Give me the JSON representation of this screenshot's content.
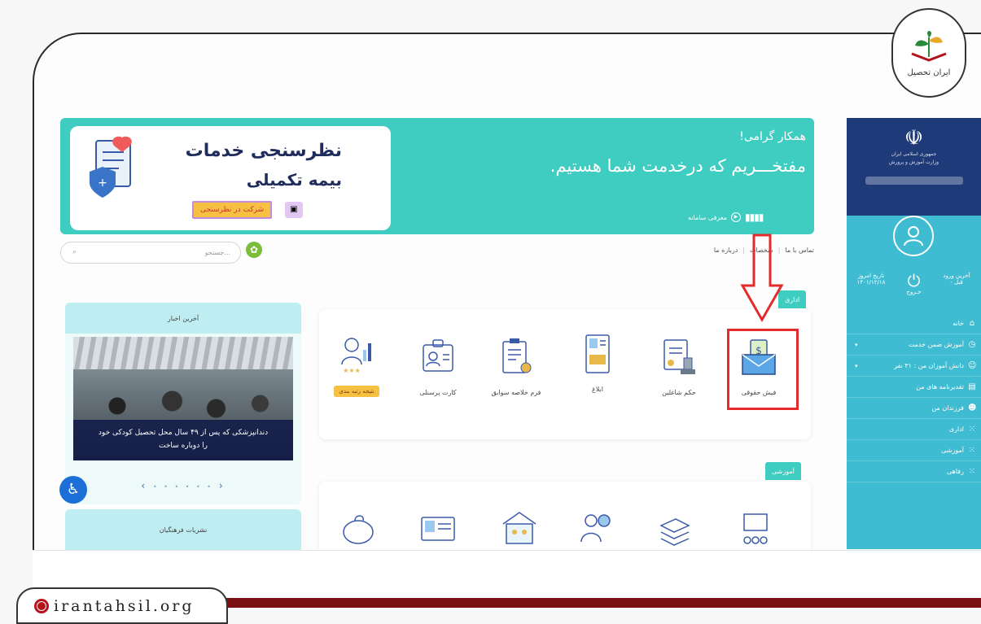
{
  "brand": {
    "name": "ایران تحصیل"
  },
  "site_url": "irantahsil.org",
  "sidebar": {
    "org_line1": "جمهوری اسلامی ایران",
    "org_line2": "وزارت آموزش و پرورش",
    "stats": {
      "last_login_label": "آخرین ورود",
      "last_login_value": "- قبل",
      "logout_label": "خـروج",
      "today_label": "تاریخ امروز",
      "today_value": "۱۴۰۱/۱۲/۱۸"
    },
    "items": [
      {
        "label": "خانه",
        "icon": "home-icon",
        "caret": false
      },
      {
        "label": "آموزش ضمن خدمت",
        "icon": "clock-icon",
        "caret": true
      },
      {
        "label": "دانش آموزان من : ۳۱ نفر",
        "icon": "users-icon",
        "caret": true
      },
      {
        "label": "تقدیرنامه های من",
        "icon": "certificate-icon",
        "caret": false
      },
      {
        "label": "فرزندان من",
        "icon": "children-icon",
        "caret": false
      },
      {
        "label": "اداری",
        "icon": "grid-icon",
        "caret": false
      },
      {
        "label": "آموزشی",
        "icon": "grid-icon",
        "caret": false
      },
      {
        "label": "رفاهی",
        "icon": "grid-icon",
        "caret": false
      }
    ]
  },
  "banner": {
    "greeting": "همکار گرامی!",
    "welcome": "مفتخـــریم که درخدمت شما هستیم.",
    "intro_link": "معرفی سامانه",
    "card_title1": "نظرسنجی خدمات",
    "card_title2": "بیمه تکمیلی",
    "card_button": "شرکت در نظرسنجی"
  },
  "search": {
    "placeholder": "جستجو..."
  },
  "toplinks": [
    "تماس با ما",
    "شخصات",
    "درباره ما"
  ],
  "news": {
    "header": "آخرین اخبار",
    "caption_line1": "دندانپزشکی که پس از ۴۹ سال محل تحصیل کودکی خود",
    "caption_line2": "را دوباره ساخت",
    "pager_prev": "‹",
    "pager_next": "›",
    "pager_dots": "• • • • • •"
  },
  "publications": {
    "header": "نشریات فرهنگیان"
  },
  "sections": {
    "admin_tag": "اداری",
    "edu_tag": "آموزشی",
    "admin_items": [
      {
        "label": "فیش حقوقی",
        "icon": "payslip-icon"
      },
      {
        "label": "حکم شاغلین",
        "icon": "decree-icon"
      },
      {
        "label": "ابلاغ",
        "icon": "notice-icon"
      },
      {
        "label": "فرم خلاصه سوابق",
        "icon": "record-form-icon"
      },
      {
        "label": "کارت پرسنلی",
        "icon": "personnel-card-icon"
      },
      {
        "label": "نتیجه رتبه بندی",
        "icon": "ranking-icon"
      }
    ]
  },
  "colors": {
    "teal": "#3ecdc0",
    "navy": "#1e3a78",
    "sidebar": "#3fbcd1",
    "highlight": "#e52b2b",
    "accent_yellow": "#f6c043"
  }
}
